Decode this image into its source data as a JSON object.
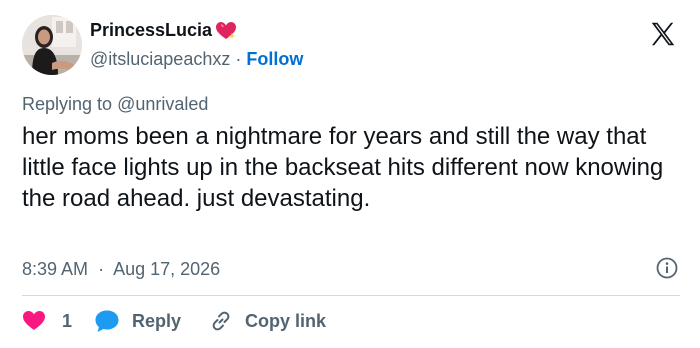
{
  "author": {
    "display_name": "PrincessLucia",
    "handle": "@itsluciapeachxz",
    "separator": "·",
    "follow_label": "Follow"
  },
  "reply_context": {
    "prefix": "Replying to",
    "mention": "@unrivaled"
  },
  "tweet": {
    "text": "her moms been a nightmare for years and still the way that little face lights up in the backseat hits different now knowing the road ahead. just devastating."
  },
  "meta": {
    "time": "8:39 AM",
    "separator": "·",
    "date": "Aug 17, 2026"
  },
  "actions": {
    "like_count": "1",
    "reply_label": "Reply",
    "copy_label": "Copy link"
  },
  "icons": {
    "brand": "x-logo-icon",
    "name_badge": "sparkling-heart-icon",
    "info": "info-icon",
    "like": "heart-icon",
    "reply": "speech-bubble-icon",
    "copy": "link-icon"
  },
  "colors": {
    "text_primary": "#0f1419",
    "text_secondary": "#536471",
    "link_blue": "#006fd6",
    "like_red": "#f91880",
    "reply_blue": "#1d9bf0",
    "divider": "#cfd9de"
  }
}
